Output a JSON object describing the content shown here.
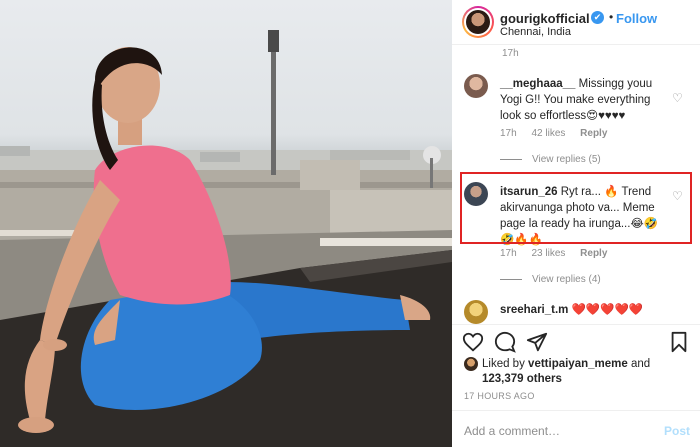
{
  "post": {
    "username": "gourigkofficial",
    "verified_mark": "✔",
    "separator": "•",
    "follow_label": "Follow",
    "location": "Chennai, India",
    "caption_time": "17h"
  },
  "comments": [
    {
      "username": "__meghaaa__",
      "text": "Missingg youu Yogi G!! You make everything look so effortless😍♥♥♥♥",
      "time": "17h",
      "likes": "42 likes",
      "reply_label": "Reply",
      "view_replies": "View replies (5)",
      "avatar_color": "#a48a7c"
    },
    {
      "username": "itsarun_26",
      "text": "Ryt ra... 🔥 Trend akirvanunga photo va... Meme page la ready ha irunga...😂🤣🤣🔥🔥",
      "time": "17h",
      "likes": "23 likes",
      "reply_label": "Reply",
      "view_replies": "View replies (4)",
      "avatar_color": "#3c4654"
    },
    {
      "username": "sreehari_t.m",
      "text": "❤️❤️❤️❤️❤️",
      "avatar_color": "#d8a531"
    }
  ],
  "actions": {
    "like_icon": "heart-outline-icon",
    "comment_icon": "comment-bubble-icon",
    "share_icon": "paper-plane-icon",
    "save_icon": "bookmark-icon"
  },
  "likes": {
    "prefix": "Liked by",
    "user": "vettipaiyan_meme",
    "connector": "and",
    "others": "123,379 others"
  },
  "timestamp": "17 HOURS AGO",
  "add_comment": {
    "placeholder": "Add a comment…",
    "post_label": "Post"
  },
  "colors": {
    "accent": "#3897f0",
    "highlight": "#e02424",
    "muted": "#8e8e8e"
  }
}
